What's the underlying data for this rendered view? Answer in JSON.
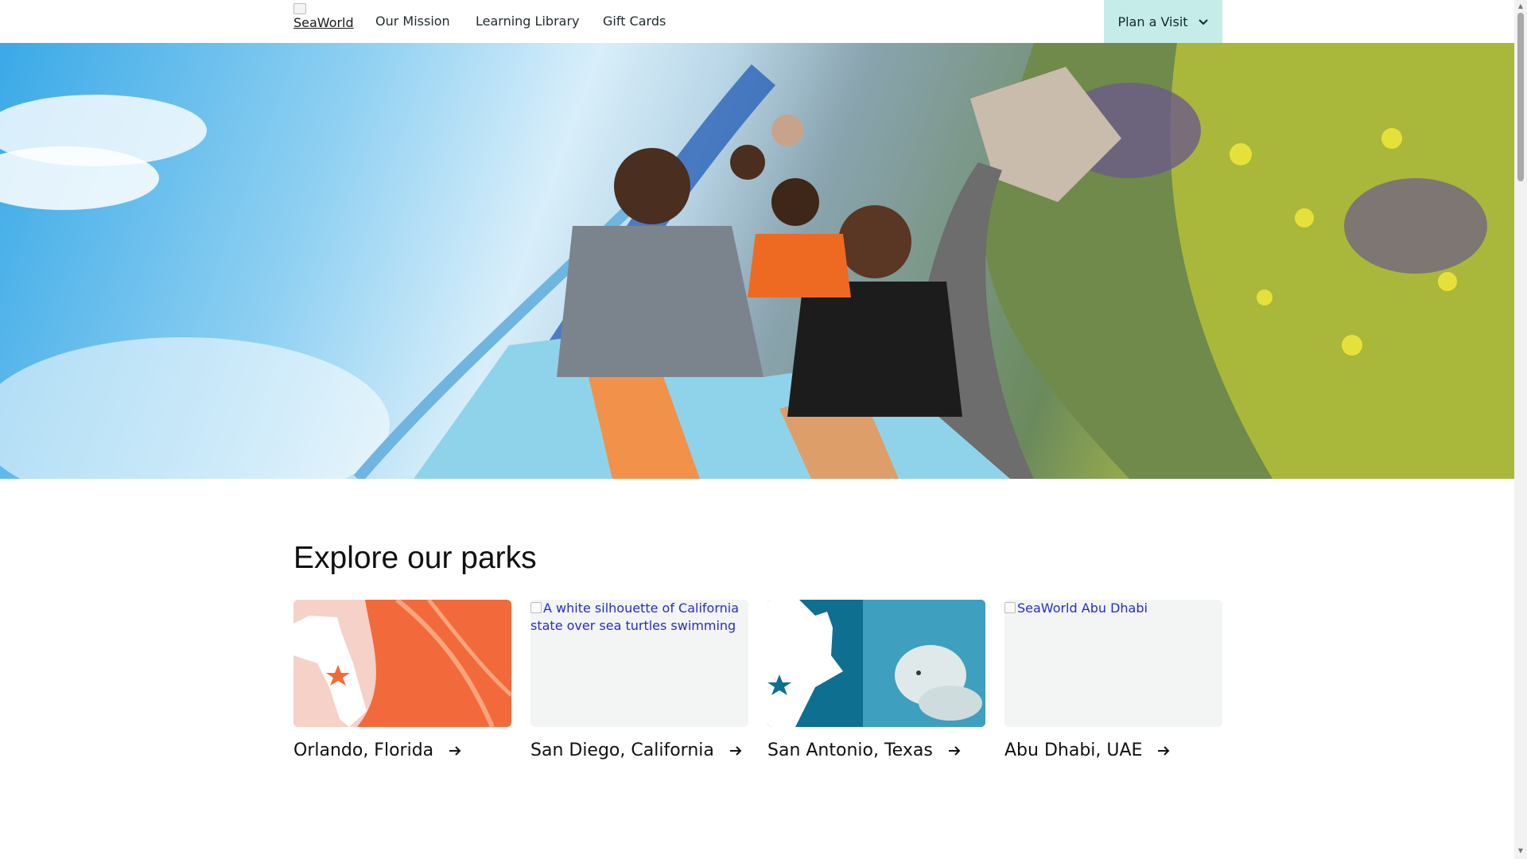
{
  "header": {
    "logo_alt": "SeaWorld",
    "nav": [
      "Our Mission",
      "Learning Library",
      "Gift Cards"
    ],
    "plan_label": "Plan a Visit"
  },
  "explore": {
    "title": "Explore our parks",
    "parks": [
      {
        "label": "Orlando, Florida",
        "image_alt": ""
      },
      {
        "label": "San Diego, California",
        "image_alt": "A white silhouette of California state over sea turtles swimming"
      },
      {
        "label": "San Antonio, Texas",
        "image_alt": ""
      },
      {
        "label": "Abu Dhabi, UAE",
        "image_alt": "SeaWorld Abu Dhabi"
      }
    ]
  },
  "colors": {
    "plan_button_bg": "#c6ece9",
    "link_blue": "#2430c8",
    "orlando_orange": "#f26a3b",
    "texas_teal": "#0f6f91"
  },
  "icons": [
    "chevron-down-icon",
    "arrow-right-icon",
    "star-icon"
  ]
}
